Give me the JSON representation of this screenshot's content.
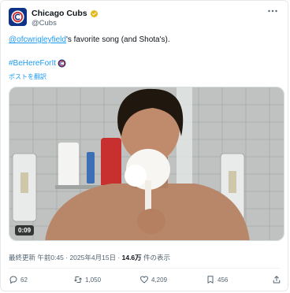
{
  "account": {
    "name": "Chicago Cubs",
    "handle": "@Cubs"
  },
  "post": {
    "mention": "@ofcwrigleyfield",
    "text_after_mention": "'s favorite song (and Shota's).",
    "hashtag": "#BeHereForIt",
    "translate": "ポストを翻訳"
  },
  "media": {
    "duration": "0:09"
  },
  "meta": {
    "prefix": "最終更新 午前0:45 · 2025年4月15日 · ",
    "views": "14.6万",
    "views_suffix": " 件の表示"
  },
  "actions": {
    "replies": "62",
    "reposts": "1,050",
    "likes": "4,209",
    "bookmarks": "456"
  },
  "colors": {
    "accent": "#1d9bf0",
    "cubs_blue": "#0e3386",
    "cubs_red": "#cc3433"
  }
}
